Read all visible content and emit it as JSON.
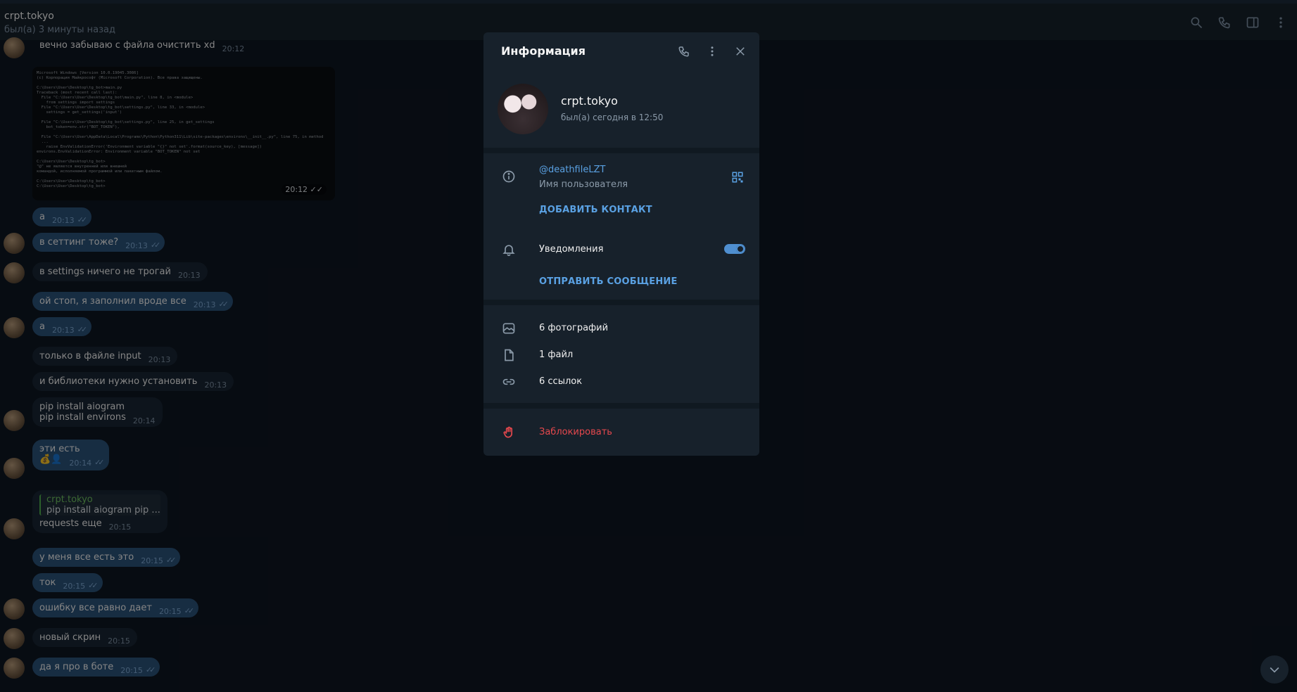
{
  "header": {
    "title": "crpt.tokyo",
    "status": "был(а) 3 минуты назад"
  },
  "messages": [
    {
      "text": "вечно забываю с файла очистить xd",
      "time": "20:12"
    },
    {
      "image_time": "20:12"
    },
    {
      "text": "а",
      "time": "20:13"
    },
    {
      "text": "в сеттинг тоже?",
      "time": "20:13"
    },
    {
      "text": "в settings ничего не трогай",
      "time": "20:13"
    },
    {
      "text": "ой стоп, я заполнил вроде все",
      "time": "20:13"
    },
    {
      "text": "а",
      "time": "20:13"
    },
    {
      "text": "только в файле input",
      "time": "20:13"
    },
    {
      "text": "и библиотеки нужно установить",
      "time": "20:13"
    },
    {
      "line1": "pip install aiogram",
      "line2": "pip install environs",
      "time": "20:14"
    },
    {
      "text": "эти есть",
      "time": "20:14"
    },
    {
      "reply_name": "crpt.tokyo",
      "reply_text": "pip install aiogram pip ...",
      "text": "requests еще",
      "time": "20:15"
    },
    {
      "text": "у меня все есть это",
      "time": "20:15"
    },
    {
      "text": "ток",
      "time": "20:15"
    },
    {
      "text": "ошибку все равно дает",
      "time": "20:15"
    },
    {
      "text": "новый скрин",
      "time": "20:15"
    },
    {
      "text": "да я про в боте",
      "time": "20:15"
    }
  ],
  "info": {
    "title": "Информация",
    "name": "crpt.tokyo",
    "seen": "был(а) сегодня в 12:50",
    "username": "@deathfileLZT",
    "username_label": "Имя пользователя",
    "add_contact": "ДОБАВИТЬ КОНТАКТ",
    "notifications": "Уведомления",
    "notifications_on": true,
    "send_message": "ОТПРАВИТЬ СООБЩЕНИЕ",
    "photos": "6 фотографий",
    "files": "1 файл",
    "links": "6 ссылок",
    "block": "Заблокировать"
  },
  "colors": {
    "background": "#0e1621",
    "panel": "#17212b",
    "accent": "#5aa1e3",
    "danger": "#e5484d",
    "outgoing": "#2b5278"
  }
}
